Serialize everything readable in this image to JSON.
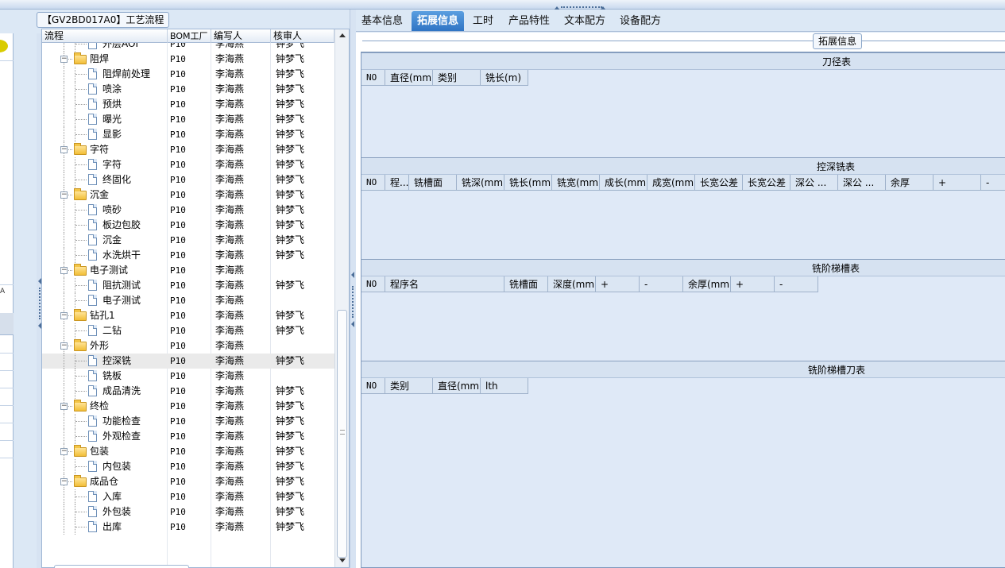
{
  "tree_panel": {
    "title": "【GV2BD017A0】工艺流程",
    "columns": [
      "流程",
      "BOM工厂",
      "编写人",
      "核审人"
    ],
    "rows": [
      {
        "level": 2,
        "type": "doc",
        "name": "外层AOI",
        "plant": "P10",
        "writer": "李海燕",
        "reviewer": "钟梦飞",
        "partial": true
      },
      {
        "level": 1,
        "type": "folder",
        "name": "阻焊",
        "plant": "P10",
        "writer": "李海燕",
        "reviewer": "钟梦飞"
      },
      {
        "level": 2,
        "type": "doc",
        "name": "阻焊前处理",
        "plant": "P10",
        "writer": "李海燕",
        "reviewer": "钟梦飞"
      },
      {
        "level": 2,
        "type": "doc",
        "name": "喷涂",
        "plant": "P10",
        "writer": "李海燕",
        "reviewer": "钟梦飞"
      },
      {
        "level": 2,
        "type": "doc",
        "name": "预烘",
        "plant": "P10",
        "writer": "李海燕",
        "reviewer": "钟梦飞"
      },
      {
        "level": 2,
        "type": "doc",
        "name": "曝光",
        "plant": "P10",
        "writer": "李海燕",
        "reviewer": "钟梦飞"
      },
      {
        "level": 2,
        "type": "doc",
        "name": "显影",
        "plant": "P10",
        "writer": "李海燕",
        "reviewer": "钟梦飞"
      },
      {
        "level": 1,
        "type": "folder",
        "name": "字符",
        "plant": "P10",
        "writer": "李海燕",
        "reviewer": "钟梦飞"
      },
      {
        "level": 2,
        "type": "doc",
        "name": "字符",
        "plant": "P10",
        "writer": "李海燕",
        "reviewer": "钟梦飞"
      },
      {
        "level": 2,
        "type": "doc",
        "name": "终固化",
        "plant": "P10",
        "writer": "李海燕",
        "reviewer": "钟梦飞"
      },
      {
        "level": 1,
        "type": "folder",
        "name": "沉金",
        "plant": "P10",
        "writer": "李海燕",
        "reviewer": "钟梦飞"
      },
      {
        "level": 2,
        "type": "doc",
        "name": "喷砂",
        "plant": "P10",
        "writer": "李海燕",
        "reviewer": "钟梦飞"
      },
      {
        "level": 2,
        "type": "doc",
        "name": "板边包胶",
        "plant": "P10",
        "writer": "李海燕",
        "reviewer": "钟梦飞"
      },
      {
        "level": 2,
        "type": "doc",
        "name": "沉金",
        "plant": "P10",
        "writer": "李海燕",
        "reviewer": "钟梦飞"
      },
      {
        "level": 2,
        "type": "doc",
        "name": "水洗烘干",
        "plant": "P10",
        "writer": "李海燕",
        "reviewer": "钟梦飞"
      },
      {
        "level": 1,
        "type": "folder",
        "name": "电子测试",
        "plant": "P10",
        "writer": "李海燕",
        "reviewer": ""
      },
      {
        "level": 2,
        "type": "doc",
        "name": "阻抗测试",
        "plant": "P10",
        "writer": "李海燕",
        "reviewer": "钟梦飞"
      },
      {
        "level": 2,
        "type": "doc",
        "name": "电子测试",
        "plant": "P10",
        "writer": "李海燕",
        "reviewer": ""
      },
      {
        "level": 1,
        "type": "folder",
        "name": "钻孔1",
        "plant": "P10",
        "writer": "李海燕",
        "reviewer": "钟梦飞"
      },
      {
        "level": 2,
        "type": "doc",
        "name": "二钻",
        "plant": "P10",
        "writer": "李海燕",
        "reviewer": "钟梦飞"
      },
      {
        "level": 1,
        "type": "folder",
        "name": "外形",
        "plant": "P10",
        "writer": "李海燕",
        "reviewer": ""
      },
      {
        "level": 2,
        "type": "doc",
        "name": "控深铣",
        "plant": "P10",
        "writer": "李海燕",
        "reviewer": "钟梦飞",
        "selected": true
      },
      {
        "level": 2,
        "type": "doc",
        "name": "铣板",
        "plant": "P10",
        "writer": "李海燕",
        "reviewer": ""
      },
      {
        "level": 2,
        "type": "doc",
        "name": "成品清洗",
        "plant": "P10",
        "writer": "李海燕",
        "reviewer": "钟梦飞"
      },
      {
        "level": 1,
        "type": "folder",
        "name": "终检",
        "plant": "P10",
        "writer": "李海燕",
        "reviewer": "钟梦飞"
      },
      {
        "level": 2,
        "type": "doc",
        "name": "功能检查",
        "plant": "P10",
        "writer": "李海燕",
        "reviewer": "钟梦飞"
      },
      {
        "level": 2,
        "type": "doc",
        "name": "外观检查",
        "plant": "P10",
        "writer": "李海燕",
        "reviewer": "钟梦飞"
      },
      {
        "level": 1,
        "type": "folder",
        "name": "包装",
        "plant": "P10",
        "writer": "李海燕",
        "reviewer": "钟梦飞"
      },
      {
        "level": 2,
        "type": "doc",
        "name": "内包装",
        "plant": "P10",
        "writer": "李海燕",
        "reviewer": "钟梦飞"
      },
      {
        "level": 1,
        "type": "folder",
        "name": "成品仓",
        "plant": "P10",
        "writer": "李海燕",
        "reviewer": "钟梦飞"
      },
      {
        "level": 2,
        "type": "doc",
        "name": "入库",
        "plant": "P10",
        "writer": "李海燕",
        "reviewer": "钟梦飞"
      },
      {
        "level": 2,
        "type": "doc",
        "name": "外包装",
        "plant": "P10",
        "writer": "李海燕",
        "reviewer": "钟梦飞"
      },
      {
        "level": 2,
        "type": "doc",
        "name": "出库",
        "plant": "P10",
        "writer": "李海燕",
        "reviewer": "钟梦飞"
      }
    ]
  },
  "left_pane": {
    "label": "A"
  },
  "tabs": [
    {
      "label": "基本信息",
      "active": false
    },
    {
      "label": "拓展信息",
      "active": true
    },
    {
      "label": "工时",
      "active": false
    },
    {
      "label": "产品特性",
      "active": false
    },
    {
      "label": "文本配方",
      "active": false
    },
    {
      "label": "设备配方",
      "active": false
    }
  ],
  "ext_group": {
    "legend": "拓展信息"
  },
  "sections": [
    {
      "title": "刀径表",
      "columns": [
        "NO",
        "直径(mm)",
        "类别",
        "铣长(m)"
      ]
    },
    {
      "title": "控深铣表",
      "columns": [
        "NO",
        "程...",
        "铣槽面",
        "铣深(mm)",
        "铣长(mm)",
        "铣宽(mm)",
        "成长(mm)",
        "成宽(mm)",
        "长宽公差",
        "长宽公差",
        "深公 ...",
        "深公 ...",
        "余厚",
        "+",
        "-"
      ]
    },
    {
      "title": "铣阶梯槽表",
      "columns": [
        "NO",
        "程序名",
        "铣槽面",
        "深度(mm)",
        "+",
        "-",
        "余厚(mm)",
        "+",
        "-"
      ]
    },
    {
      "title": "铣阶梯槽刀表",
      "columns": [
        "NO",
        "类别",
        "直径(mm)",
        "lth"
      ]
    }
  ],
  "colors": {
    "tab_active": "#2f74c4",
    "panel_bg": "#dfe9f7",
    "folder": "#f2be37"
  }
}
